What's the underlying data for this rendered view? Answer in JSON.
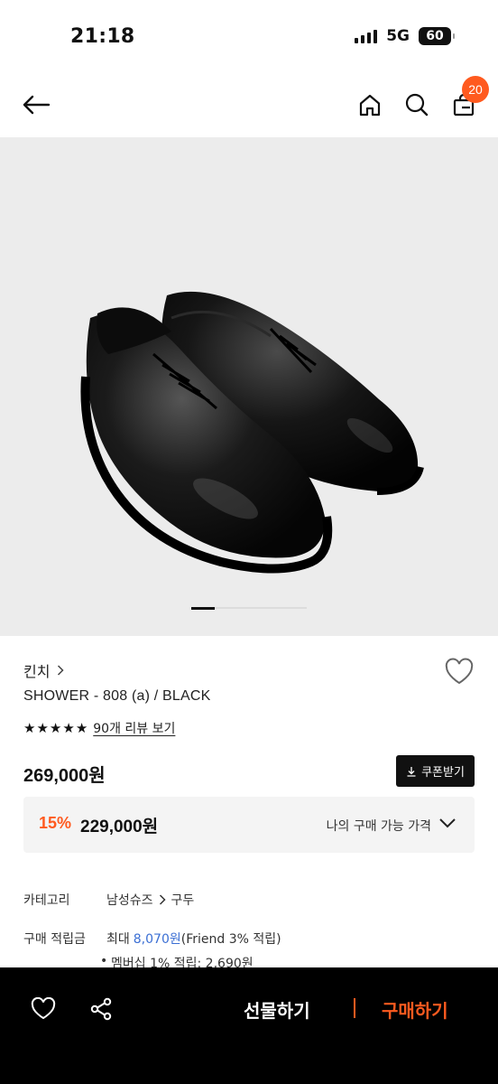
{
  "status_bar": {
    "time": "21:18",
    "network": "5G",
    "battery": "60"
  },
  "header": {
    "cart_count": "20"
  },
  "gallery": {
    "active_index": 0
  },
  "product": {
    "brand": "킨치",
    "name": "SHOWER - 808 (a) / BLACK",
    "rating_stars": 5,
    "review_link": "90개 리뷰 보기",
    "price": "269,000원",
    "coupon_label": "쿠폰받기",
    "discount_rate": "15%",
    "sale_price": "229,000원",
    "my_price_label": "나의 구매 가능 가격"
  },
  "details": {
    "category_label": "카테고리",
    "category_path": [
      "남성슈즈",
      "구두"
    ],
    "points_label": "구매 적립금",
    "points_prefix": "최대",
    "points_value": "8,070원",
    "points_suffix": "(Friend 3% 적립)",
    "membership_line": "멤버십 1% 적립: 2,690원"
  },
  "bottom_bar": {
    "gift_label": "선물하기",
    "buy_label": "구매하기"
  }
}
